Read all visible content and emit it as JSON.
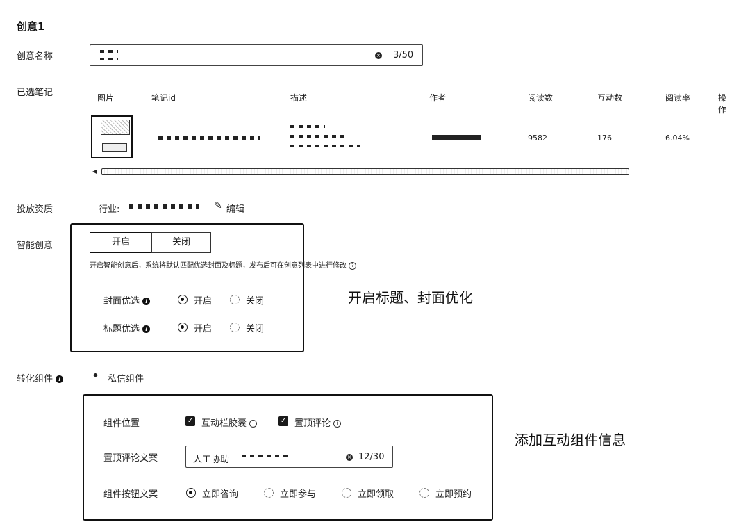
{
  "section_title": "创意1",
  "creative_name": {
    "label": "创意名称",
    "value": "",
    "counter": "3/50"
  },
  "selected_notes": {
    "label": "已选笔记",
    "columns": [
      "图片",
      "笔记id",
      "描述",
      "作者",
      "阅读数",
      "互动数",
      "阅读率",
      "操作"
    ],
    "row": {
      "reads": "9582",
      "interactions": "176",
      "read_rate": "6.04%"
    }
  },
  "qualification": {
    "label": "投放资质",
    "industry_label": "行业:",
    "edit_label": "编辑"
  },
  "smart_creative": {
    "label": "智能创意",
    "on_label": "开启",
    "off_label": "关闭",
    "hint": "开启智能创意后，系统将默认匹配优选封面及标题，发布后可在创意列表中进行修改",
    "cover_label": "封面优选",
    "title_label": "标题优选",
    "radio_on": "开启",
    "radio_off": "关闭"
  },
  "conversion": {
    "label": "转化组件",
    "component_name": "私信组件",
    "position_label": "组件位置",
    "position_options": [
      "互动栏胶囊",
      "置顶评论"
    ],
    "pinned_label": "置顶评论文案",
    "pinned_value": "人工协助",
    "pinned_counter": "12/30",
    "button_label": "组件按钮文案",
    "button_options": [
      "立即咨询",
      "立即参与",
      "立即领取",
      "立即预约"
    ]
  },
  "annotations": {
    "smart": "开启标题、封面优化",
    "component": "添加互动组件信息"
  }
}
